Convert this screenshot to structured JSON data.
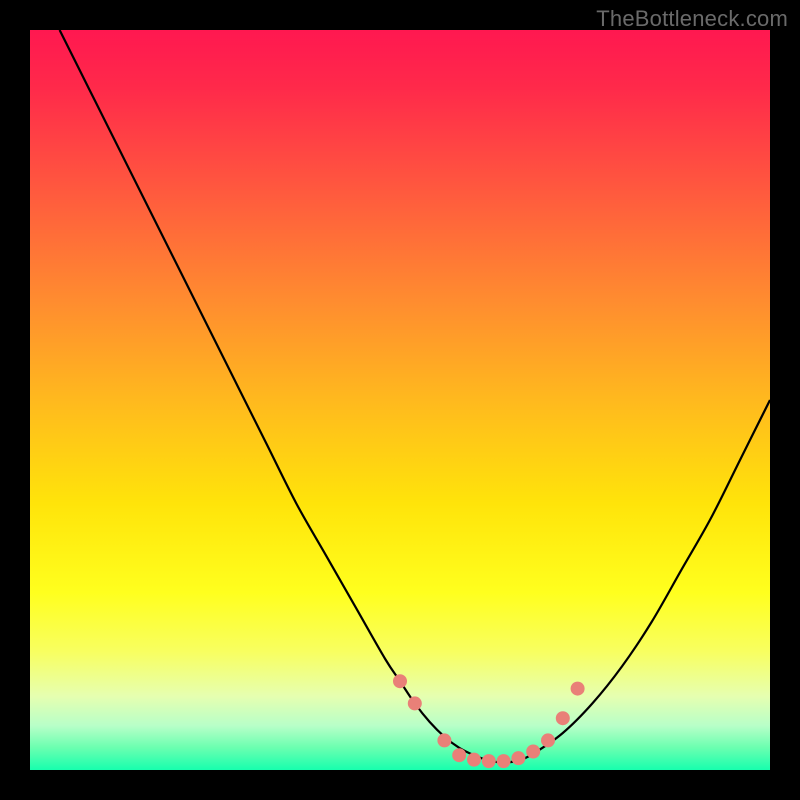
{
  "watermark": "TheBottleneck.com",
  "chart_data": {
    "type": "line",
    "title": "",
    "subtitle": "",
    "xlabel": "",
    "ylabel": "",
    "xlim": [
      0,
      100
    ],
    "ylim": [
      0,
      100
    ],
    "grid": false,
    "legend": false,
    "annotations": [],
    "background_gradient_stops": [
      {
        "pos": 0,
        "color": "#ff1850"
      },
      {
        "pos": 8,
        "color": "#ff2a4a"
      },
      {
        "pos": 22,
        "color": "#ff5a3e"
      },
      {
        "pos": 36,
        "color": "#ff8a30"
      },
      {
        "pos": 50,
        "color": "#ffb91e"
      },
      {
        "pos": 64,
        "color": "#ffe40a"
      },
      {
        "pos": 76,
        "color": "#ffff1e"
      },
      {
        "pos": 84,
        "color": "#f8ff60"
      },
      {
        "pos": 90,
        "color": "#e6ffb0"
      },
      {
        "pos": 94,
        "color": "#b8ffc8"
      },
      {
        "pos": 97,
        "color": "#6affb0"
      },
      {
        "pos": 100,
        "color": "#17ffae"
      }
    ],
    "series": [
      {
        "name": "curve",
        "stroke": "#000000",
        "stroke_width": 2.2,
        "x": [
          4,
          8,
          12,
          16,
          20,
          24,
          28,
          32,
          36,
          40,
          44,
          48,
          50,
          52,
          54,
          56,
          58,
          60,
          62,
          64,
          66,
          68,
          72,
          76,
          80,
          84,
          88,
          92,
          96,
          100
        ],
        "y": [
          100,
          92,
          84,
          76,
          68,
          60,
          52,
          44,
          36,
          29,
          22,
          15,
          12,
          9,
          6.5,
          4.5,
          3,
          2,
          1.3,
          1,
          1.3,
          2.2,
          5,
          9,
          14,
          20,
          27,
          34,
          42,
          50
        ]
      }
    ],
    "markers": {
      "name": "highlight-points",
      "fill": "#e98078",
      "radius": 7,
      "points": [
        {
          "x": 50,
          "y": 12
        },
        {
          "x": 52,
          "y": 9
        },
        {
          "x": 56,
          "y": 4
        },
        {
          "x": 58,
          "y": 2
        },
        {
          "x": 60,
          "y": 1.4
        },
        {
          "x": 62,
          "y": 1.2
        },
        {
          "x": 64,
          "y": 1.2
        },
        {
          "x": 66,
          "y": 1.6
        },
        {
          "x": 68,
          "y": 2.5
        },
        {
          "x": 70,
          "y": 4
        },
        {
          "x": 72,
          "y": 7
        },
        {
          "x": 74,
          "y": 11
        }
      ]
    }
  }
}
